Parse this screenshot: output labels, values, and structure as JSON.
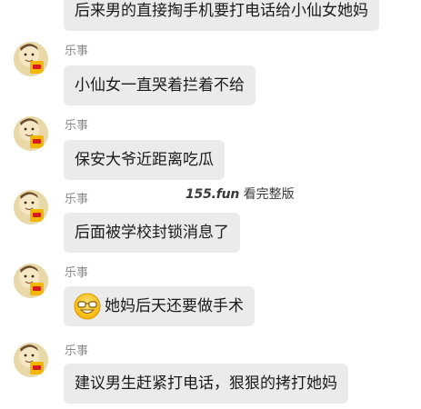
{
  "messages": [
    {
      "sender": "",
      "text": "后来男的直接掏手机要打电话给小仙女她妈"
    },
    {
      "sender": "乐事",
      "text": "小仙女一直哭着拦着不给"
    },
    {
      "sender": "乐事",
      "text": "保安大爷近距离吃瓜"
    },
    {
      "sender": "乐事",
      "text": "后面被学校封锁消息了"
    },
    {
      "sender": "乐事",
      "text": "她妈后天还要做手术",
      "emoji": "smiling-face-glasses-emoji"
    },
    {
      "sender": "乐事",
      "text": "建议男生赶紧打电话，狠狠的拷打她妈"
    }
  ],
  "watermark": {
    "domain": "155.fun",
    "label": "看完整版"
  },
  "colors": {
    "bubble": "#ebebeb",
    "sender": "#8a8a8a",
    "avatar_bg": "#e9d9a8",
    "chip_bag": "#f2b705"
  }
}
